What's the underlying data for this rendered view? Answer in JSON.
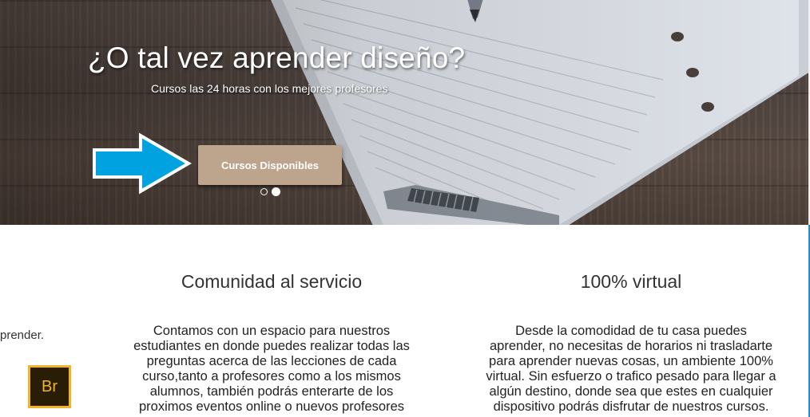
{
  "hero": {
    "title": "¿O tal vez aprender diseño?",
    "subtitle": "Cursos las 24 horas con los mejores profesores",
    "button_label": "Cursos Disponibles",
    "slides_total": 2,
    "active_slide": 2,
    "button_color": "#bda48c",
    "arrow_color": "#00a3e0"
  },
  "features": {
    "partial_text": "prender.",
    "items": [
      {
        "title": "Comunidad al servicio",
        "lines": [
          "Contamos con un espacio para nuestros",
          "estudiantes en donde puedes realizar todas las",
          "preguntas acerca de las lecciones de cada",
          "curso,tanto a profesores como a los mismos",
          "alumnos, también podrás enterarte de los",
          "proximos eventos online o nuevos profesores"
        ]
      },
      {
        "title": "100% virtual",
        "lines": [
          "Desde la comodidad de tu casa puedes",
          "aprender, no necesitas de horarios ni trasladarte",
          "para aprender nuevas cosas, un ambiente 100%",
          "virtual. Sin esfuerzo o trafico pesado para llegar a",
          "algún destino, donde sea que estes en cualquier",
          "dispositivo podrás disfrutar de nuestros cursos."
        ]
      }
    ]
  },
  "taskbar_icon": {
    "label": "Br",
    "name": "adobe-bridge-icon",
    "accent": "#f0b526"
  }
}
